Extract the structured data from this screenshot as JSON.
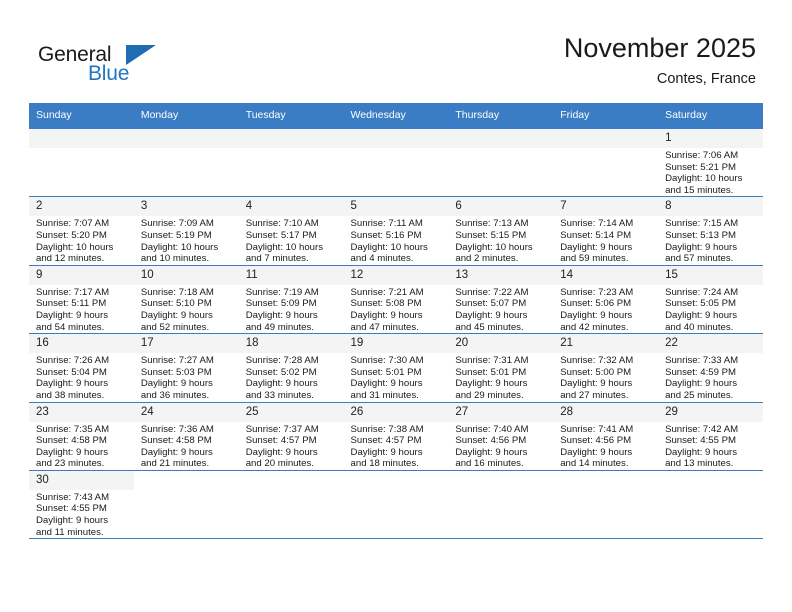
{
  "brand": {
    "name_top": "General",
    "name_bottom": "Blue",
    "logo_icon": "triangle-logo-icon",
    "color_black": "#1a1a1a",
    "color_blue": "#2077c0"
  },
  "header": {
    "title": "November 2025",
    "subtitle": "Contes, France"
  },
  "colors": {
    "header_row_bg": "#3b7dc4",
    "header_row_text": "#ffffff",
    "daynum_bg": "#f4f4f4",
    "grid_line": "#3b7dc4",
    "page_bg": "#ffffff"
  },
  "weekdays": [
    "Sunday",
    "Monday",
    "Tuesday",
    "Wednesday",
    "Thursday",
    "Friday",
    "Saturday"
  ],
  "labels": {
    "sunrise_prefix": "Sunrise:",
    "sunset_prefix": "Sunset:",
    "daylight_prefix": "Daylight:"
  },
  "weeks": [
    [
      {
        "empty": true
      },
      {
        "empty": true
      },
      {
        "empty": true
      },
      {
        "empty": true
      },
      {
        "empty": true
      },
      {
        "empty": true
      },
      {
        "day": "1",
        "sunrise": "Sunrise: 7:06 AM",
        "sunset": "Sunset: 5:21 PM",
        "daylight_1": "Daylight: 10 hours",
        "daylight_2": "and 15 minutes."
      }
    ],
    [
      {
        "day": "2",
        "sunrise": "Sunrise: 7:07 AM",
        "sunset": "Sunset: 5:20 PM",
        "daylight_1": "Daylight: 10 hours",
        "daylight_2": "and 12 minutes."
      },
      {
        "day": "3",
        "sunrise": "Sunrise: 7:09 AM",
        "sunset": "Sunset: 5:19 PM",
        "daylight_1": "Daylight: 10 hours",
        "daylight_2": "and 10 minutes."
      },
      {
        "day": "4",
        "sunrise": "Sunrise: 7:10 AM",
        "sunset": "Sunset: 5:17 PM",
        "daylight_1": "Daylight: 10 hours",
        "daylight_2": "and 7 minutes."
      },
      {
        "day": "5",
        "sunrise": "Sunrise: 7:11 AM",
        "sunset": "Sunset: 5:16 PM",
        "daylight_1": "Daylight: 10 hours",
        "daylight_2": "and 4 minutes."
      },
      {
        "day": "6",
        "sunrise": "Sunrise: 7:13 AM",
        "sunset": "Sunset: 5:15 PM",
        "daylight_1": "Daylight: 10 hours",
        "daylight_2": "and 2 minutes."
      },
      {
        "day": "7",
        "sunrise": "Sunrise: 7:14 AM",
        "sunset": "Sunset: 5:14 PM",
        "daylight_1": "Daylight: 9 hours",
        "daylight_2": "and 59 minutes."
      },
      {
        "day": "8",
        "sunrise": "Sunrise: 7:15 AM",
        "sunset": "Sunset: 5:13 PM",
        "daylight_1": "Daylight: 9 hours",
        "daylight_2": "and 57 minutes."
      }
    ],
    [
      {
        "day": "9",
        "sunrise": "Sunrise: 7:17 AM",
        "sunset": "Sunset: 5:11 PM",
        "daylight_1": "Daylight: 9 hours",
        "daylight_2": "and 54 minutes."
      },
      {
        "day": "10",
        "sunrise": "Sunrise: 7:18 AM",
        "sunset": "Sunset: 5:10 PM",
        "daylight_1": "Daylight: 9 hours",
        "daylight_2": "and 52 minutes."
      },
      {
        "day": "11",
        "sunrise": "Sunrise: 7:19 AM",
        "sunset": "Sunset: 5:09 PM",
        "daylight_1": "Daylight: 9 hours",
        "daylight_2": "and 49 minutes."
      },
      {
        "day": "12",
        "sunrise": "Sunrise: 7:21 AM",
        "sunset": "Sunset: 5:08 PM",
        "daylight_1": "Daylight: 9 hours",
        "daylight_2": "and 47 minutes."
      },
      {
        "day": "13",
        "sunrise": "Sunrise: 7:22 AM",
        "sunset": "Sunset: 5:07 PM",
        "daylight_1": "Daylight: 9 hours",
        "daylight_2": "and 45 minutes."
      },
      {
        "day": "14",
        "sunrise": "Sunrise: 7:23 AM",
        "sunset": "Sunset: 5:06 PM",
        "daylight_1": "Daylight: 9 hours",
        "daylight_2": "and 42 minutes."
      },
      {
        "day": "15",
        "sunrise": "Sunrise: 7:24 AM",
        "sunset": "Sunset: 5:05 PM",
        "daylight_1": "Daylight: 9 hours",
        "daylight_2": "and 40 minutes."
      }
    ],
    [
      {
        "day": "16",
        "sunrise": "Sunrise: 7:26 AM",
        "sunset": "Sunset: 5:04 PM",
        "daylight_1": "Daylight: 9 hours",
        "daylight_2": "and 38 minutes."
      },
      {
        "day": "17",
        "sunrise": "Sunrise: 7:27 AM",
        "sunset": "Sunset: 5:03 PM",
        "daylight_1": "Daylight: 9 hours",
        "daylight_2": "and 36 minutes."
      },
      {
        "day": "18",
        "sunrise": "Sunrise: 7:28 AM",
        "sunset": "Sunset: 5:02 PM",
        "daylight_1": "Daylight: 9 hours",
        "daylight_2": "and 33 minutes."
      },
      {
        "day": "19",
        "sunrise": "Sunrise: 7:30 AM",
        "sunset": "Sunset: 5:01 PM",
        "daylight_1": "Daylight: 9 hours",
        "daylight_2": "and 31 minutes."
      },
      {
        "day": "20",
        "sunrise": "Sunrise: 7:31 AM",
        "sunset": "Sunset: 5:01 PM",
        "daylight_1": "Daylight: 9 hours",
        "daylight_2": "and 29 minutes."
      },
      {
        "day": "21",
        "sunrise": "Sunrise: 7:32 AM",
        "sunset": "Sunset: 5:00 PM",
        "daylight_1": "Daylight: 9 hours",
        "daylight_2": "and 27 minutes."
      },
      {
        "day": "22",
        "sunrise": "Sunrise: 7:33 AM",
        "sunset": "Sunset: 4:59 PM",
        "daylight_1": "Daylight: 9 hours",
        "daylight_2": "and 25 minutes."
      }
    ],
    [
      {
        "day": "23",
        "sunrise": "Sunrise: 7:35 AM",
        "sunset": "Sunset: 4:58 PM",
        "daylight_1": "Daylight: 9 hours",
        "daylight_2": "and 23 minutes."
      },
      {
        "day": "24",
        "sunrise": "Sunrise: 7:36 AM",
        "sunset": "Sunset: 4:58 PM",
        "daylight_1": "Daylight: 9 hours",
        "daylight_2": "and 21 minutes."
      },
      {
        "day": "25",
        "sunrise": "Sunrise: 7:37 AM",
        "sunset": "Sunset: 4:57 PM",
        "daylight_1": "Daylight: 9 hours",
        "daylight_2": "and 20 minutes."
      },
      {
        "day": "26",
        "sunrise": "Sunrise: 7:38 AM",
        "sunset": "Sunset: 4:57 PM",
        "daylight_1": "Daylight: 9 hours",
        "daylight_2": "and 18 minutes."
      },
      {
        "day": "27",
        "sunrise": "Sunrise: 7:40 AM",
        "sunset": "Sunset: 4:56 PM",
        "daylight_1": "Daylight: 9 hours",
        "daylight_2": "and 16 minutes."
      },
      {
        "day": "28",
        "sunrise": "Sunrise: 7:41 AM",
        "sunset": "Sunset: 4:56 PM",
        "daylight_1": "Daylight: 9 hours",
        "daylight_2": "and 14 minutes."
      },
      {
        "day": "29",
        "sunrise": "Sunrise: 7:42 AM",
        "sunset": "Sunset: 4:55 PM",
        "daylight_1": "Daylight: 9 hours",
        "daylight_2": "and 13 minutes."
      }
    ],
    [
      {
        "day": "30",
        "sunrise": "Sunrise: 7:43 AM",
        "sunset": "Sunset: 4:55 PM",
        "daylight_1": "Daylight: 9 hours",
        "daylight_2": "and 11 minutes."
      },
      {
        "empty": true
      },
      {
        "empty": true
      },
      {
        "empty": true
      },
      {
        "empty": true
      },
      {
        "empty": true
      },
      {
        "empty": true
      }
    ]
  ]
}
